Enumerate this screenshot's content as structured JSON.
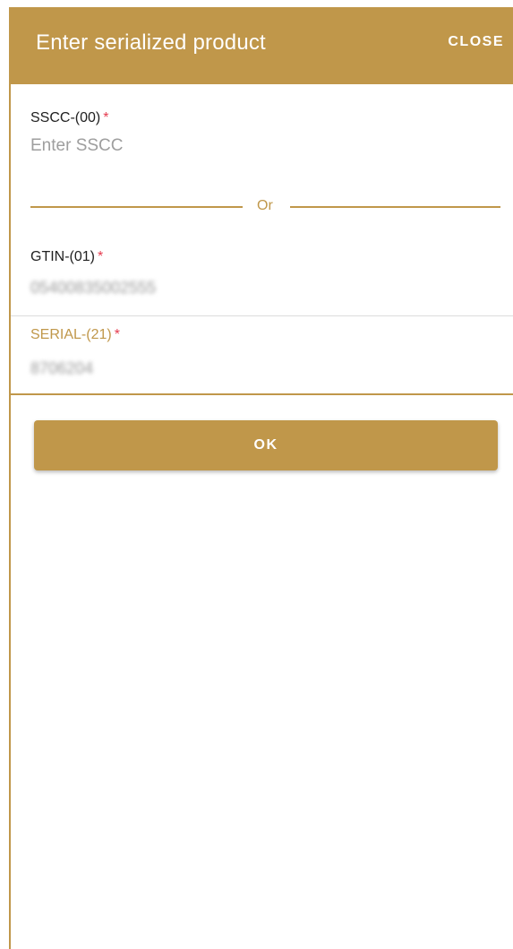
{
  "dialog": {
    "title": "Enter serialized product",
    "close_label": "CLOSE"
  },
  "sscc": {
    "label": "SSCC-(00)",
    "required_mark": "*",
    "placeholder": "Enter SSCC"
  },
  "divider": {
    "text": "Or"
  },
  "gtin": {
    "label": "GTIN-(01)",
    "required_mark": "*",
    "value": "05400835002555"
  },
  "serial": {
    "label": "SERIAL-(21)",
    "required_mark": "*",
    "value": "8706204"
  },
  "ok_label": "OK",
  "colors": {
    "accent": "#c0974a",
    "required": "#e53b4f",
    "divider_gray": "#dcdcdc"
  }
}
